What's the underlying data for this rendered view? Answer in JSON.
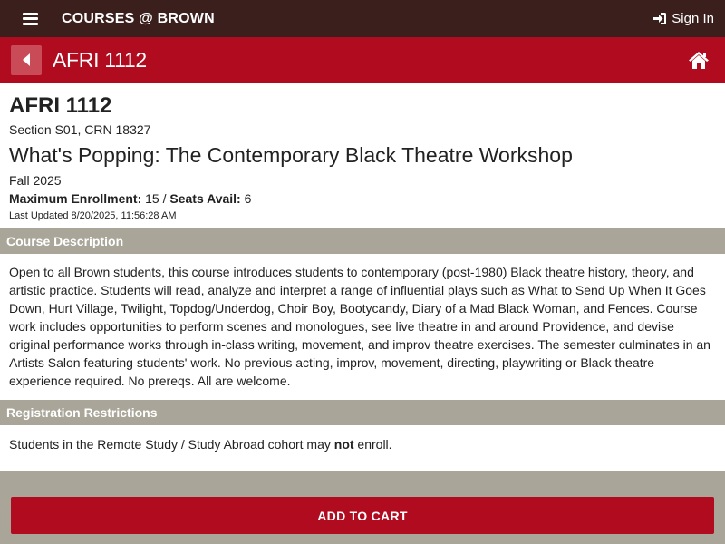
{
  "header": {
    "brand": "COURSES @ BROWN",
    "signin_label": "Sign In"
  },
  "subheader": {
    "title": "AFRI 1112"
  },
  "course": {
    "code": "AFRI 1112",
    "section": "Section S01, CRN 18327",
    "title": "What's Popping: The Contemporary Black Theatre Workshop",
    "term": "Fall 2025",
    "max_enrollment_label": "Maximum Enrollment:",
    "max_enrollment_value": " 15 / ",
    "seats_avail_label": "Seats Avail:",
    "seats_avail_value": " 6",
    "last_updated": "Last Updated 8/20/2025, 11:56:28 AM"
  },
  "description": {
    "header": "Course Description",
    "text": "Open to all Brown students, this course introduces students to contemporary (post-1980) Black theatre history, theory, and artistic practice. Students will read, analyze and interpret a range of influential plays such as What to Send Up When It Goes Down, Hurt Village, Twilight, Topdog/Underdog, Choir Boy, Bootycandy, Diary of a Mad Black Woman, and Fences. Course work includes opportunities to perform scenes and monologues, see live theatre in and around Providence, and devise original performance works through in-class writing, movement, and improv theatre exercises. The semester culminates in an Artists Salon featuring students' work. No previous acting, improv, movement, directing, playwriting or Black theatre experience required. No prereqs. All are welcome."
  },
  "restrictions": {
    "header": "Registration Restrictions",
    "text_before": "Students in the Remote Study / Study Abroad cohort may ",
    "text_bold": "not",
    "text_after": " enroll."
  },
  "actions": {
    "add_to_cart": "ADD TO CART"
  },
  "colors": {
    "topbar": "#3b1f1d",
    "brand_red": "#b00b1e",
    "section_gray": "#a9a598"
  },
  "icons": {
    "menu": "hamburger-menu-icon",
    "signin": "sign-in-icon",
    "back": "caret-left-icon",
    "home": "home-icon"
  }
}
